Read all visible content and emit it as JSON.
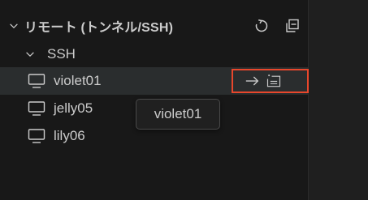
{
  "section": {
    "title": "リモート (トンネル/SSH)",
    "refresh_icon": "refresh-icon",
    "collapse_icon": "collapse-all-icon"
  },
  "group": {
    "label": "SSH",
    "icon": "chevron-down-icon"
  },
  "hosts": [
    {
      "label": "violet01",
      "icon": "monitor-icon",
      "selected": true
    },
    {
      "label": "jelly05",
      "icon": "monitor-icon",
      "selected": false
    },
    {
      "label": "lily06",
      "icon": "monitor-icon",
      "selected": false
    }
  ],
  "row_actions": {
    "connect_icon": "arrow-right-icon",
    "new_window_icon": "open-in-new-window-icon",
    "highlight_color": "#e8472c"
  },
  "tooltip": {
    "text": "violet01"
  },
  "colors": {
    "panel_bg": "#181818",
    "selected_bg": "#2a2d2e",
    "text": "#cccccc"
  }
}
